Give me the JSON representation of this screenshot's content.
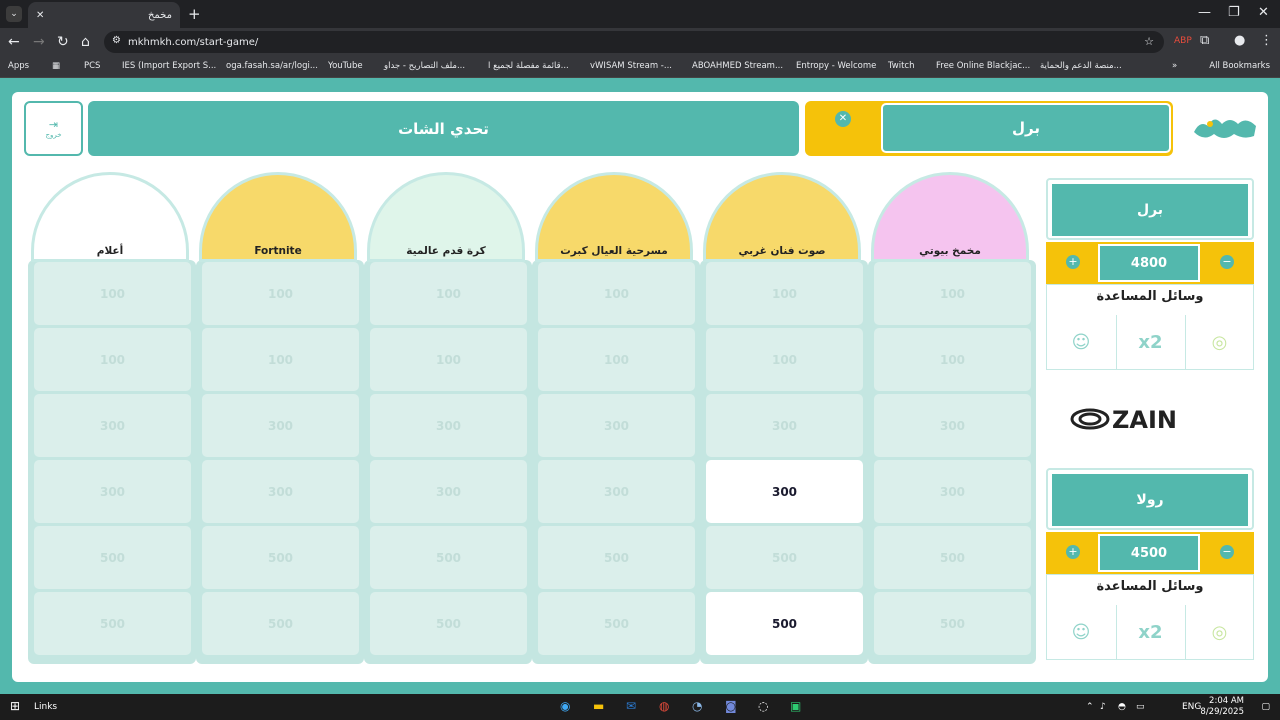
{
  "browser": {
    "tab_title": "مخمخ",
    "url": "mkhmkh.com/start-game/",
    "bookmarks": [
      "Apps",
      "PCS",
      "IES (Import Export S...",
      "oga.fasah.sa/ar/logi...",
      "YouTube",
      "ملف التصاريح - جداو...",
      "قائمة مفصلة لجميع ا...",
      "vWISAM Stream -...",
      "ABOAHMED Stream...",
      "Entropy - Welcome",
      "Twitch",
      "Free Online Blackjac...",
      "منصة الدعم والحماية..."
    ],
    "all_bookmarks": "All Bookmarks"
  },
  "header": {
    "current_team": "برل",
    "game_title": "تحدي الشات",
    "exit_label": "خروج",
    "skip_label": "..."
  },
  "categories": [
    {
      "label": "مخمخ بيوتي",
      "bg": "#f5c4ef",
      "values": [
        "100",
        "100",
        "300",
        "300",
        "500",
        "500"
      ],
      "live": [
        false,
        false,
        false,
        false,
        false,
        false
      ]
    },
    {
      "label": "صوت فنان غربي",
      "bg": "#f7d96a",
      "values": [
        "100",
        "100",
        "300",
        "300",
        "500",
        "500"
      ],
      "live": [
        false,
        false,
        false,
        true,
        false,
        true
      ]
    },
    {
      "label": "مسرحية العيال كبرت",
      "bg": "#f7d96a",
      "values": [
        "100",
        "100",
        "300",
        "300",
        "500",
        "500"
      ],
      "live": [
        false,
        false,
        false,
        false,
        false,
        false
      ]
    },
    {
      "label": "كرة قدم عالمية",
      "bg": "#dff5ea",
      "values": [
        "100",
        "100",
        "300",
        "300",
        "500",
        "500"
      ],
      "live": [
        false,
        false,
        false,
        false,
        false,
        false
      ]
    },
    {
      "label": "Fortnite",
      "bg": "#f7d96a",
      "values": [
        "100",
        "100",
        "300",
        "300",
        "500",
        "500"
      ],
      "live": [
        false,
        false,
        false,
        false,
        false,
        false
      ]
    },
    {
      "label": "أعلام",
      "bg": "#ffffff",
      "values": [
        "100",
        "100",
        "300",
        "300",
        "500",
        "500"
      ],
      "live": [
        false,
        false,
        false,
        false,
        false,
        false
      ]
    }
  ],
  "teams": [
    {
      "name": "برل",
      "score": "4800",
      "aids_title": "وسائل المساعدة"
    },
    {
      "name": "رولا",
      "score": "4500",
      "aids_title": "وسائل المساعدة"
    }
  ],
  "sponsor": "ZAIN",
  "taskbar": {
    "links": "Links",
    "lang": "ENG",
    "time": "2:04 AM",
    "date": "8/29/2025"
  },
  "colors": {
    "teal": "#53b8ad",
    "yellow": "#f5c20a",
    "tile": "#dbefeb"
  }
}
